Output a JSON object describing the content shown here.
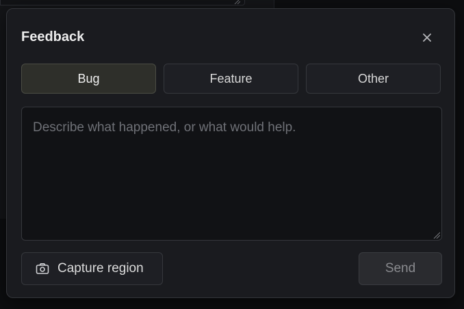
{
  "dialog": {
    "title": "Feedback",
    "close_icon": "close-icon"
  },
  "types": {
    "selected": "Bug",
    "options": [
      {
        "label": "Bug"
      },
      {
        "label": "Feature"
      },
      {
        "label": "Other"
      }
    ]
  },
  "message": {
    "value": "",
    "placeholder": "Describe what happened, or what would help."
  },
  "actions": {
    "capture_label": "Capture region",
    "capture_icon": "camera-icon",
    "send_label": "Send"
  },
  "colors": {
    "dialog_bg": "#1a1b1f",
    "selected_bg": "#2e2f2a",
    "send_disabled_text": "#8a8b8f"
  }
}
